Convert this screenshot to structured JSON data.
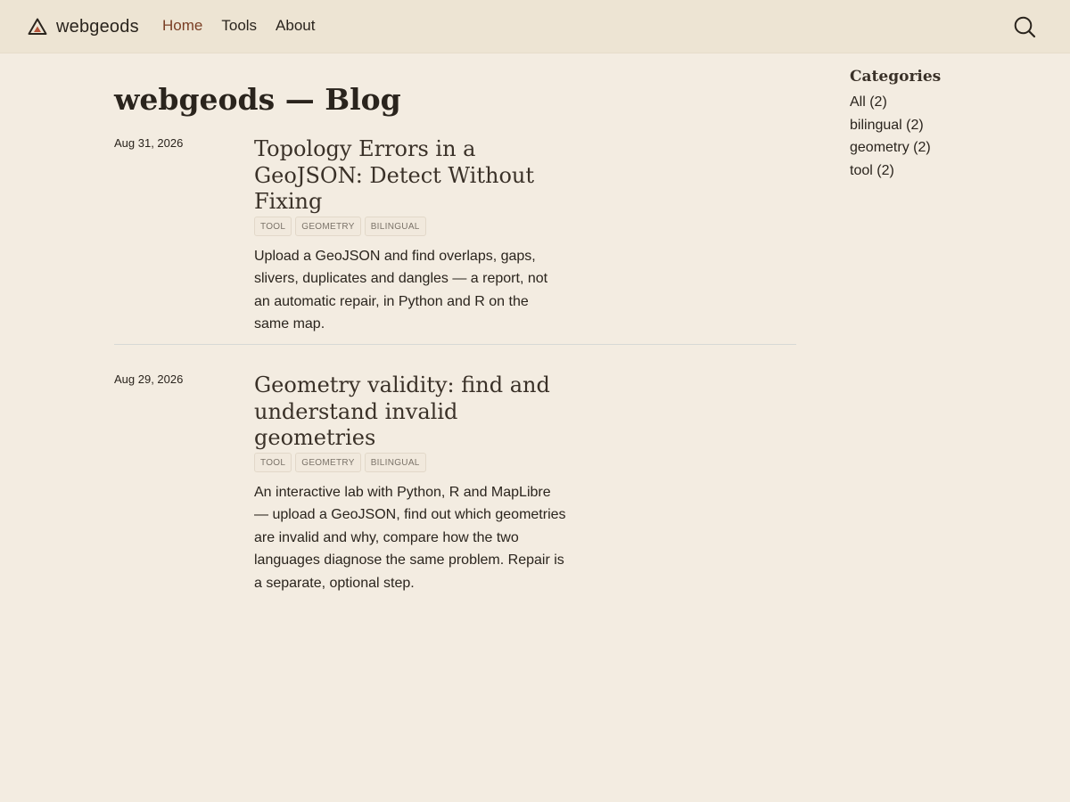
{
  "brand": {
    "name": "webgeods",
    "icon": "triangle-warning-icon"
  },
  "nav": {
    "home": "Home",
    "tools": "Tools",
    "about": "About"
  },
  "search": {
    "icon": "search-icon"
  },
  "page": {
    "title": "webgeods — Blog"
  },
  "posts": [
    {
      "date": "Aug 31, 2026",
      "title": "Topology Errors in a GeoJSON: Detect Without Fixing",
      "tags": [
        "tool",
        "geometry",
        "bilingual"
      ],
      "excerpt": "Upload a GeoJSON and find overlaps, gaps, slivers, duplicates and dangles — a report, not an automatic repair, in Python and R on the same map."
    },
    {
      "date": "Aug 29, 2026",
      "title": "Geometry validity: find and understand invalid geometries",
      "tags": [
        "tool",
        "geometry",
        "bilingual"
      ],
      "excerpt": "An interactive lab with Python, R and MapLibre — upload a GeoJSON, find out which geometries are invalid and why, compare how the two languages diagnose the same problem. Repair is a separate, optional step."
    }
  ],
  "sidebar": {
    "title": "Categories",
    "items": [
      "All (2)",
      "bilingual (2)",
      "geometry (2)",
      "tool (2)"
    ]
  },
  "colors": {
    "background": "#f3ece1",
    "navbar": "#ede4d3",
    "accent": "#7a3e24",
    "text": "#2a241d"
  }
}
